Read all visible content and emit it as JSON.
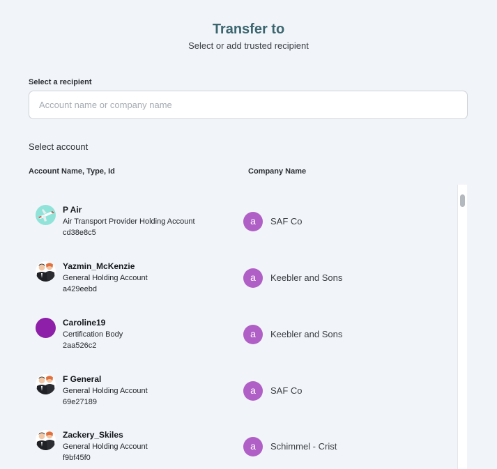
{
  "header": {
    "title": "Transfer to",
    "subtitle": "Select or add trusted recipient"
  },
  "recipient": {
    "label": "Select a recipient",
    "placeholder": "Account name or company name",
    "value": ""
  },
  "accounts": {
    "section_label": "Select account",
    "columns": {
      "account": "Account Name, Type, Id",
      "company": "Company Name"
    },
    "rows": [
      {
        "name": "P Air",
        "type": "Air Transport Provider Holding Account",
        "id": "cd38e8c5",
        "avatar_icon": "airplane-avatar-icon",
        "company_initial": "a",
        "company": "SAF Co"
      },
      {
        "name": "Yazmin_McKenzie",
        "type": "General Holding Account",
        "id": "a429eebd",
        "avatar_icon": "people-avatar-icon",
        "company_initial": "a",
        "company": "Keebler and Sons"
      },
      {
        "name": "Caroline19",
        "type": "Certification Body",
        "id": "2aa526c2",
        "avatar_icon": "purple-circle-avatar-icon",
        "company_initial": "a",
        "company": "Keebler and Sons"
      },
      {
        "name": "F General",
        "type": "General Holding Account",
        "id": "69e27189",
        "avatar_icon": "people-avatar-icon",
        "company_initial": "a",
        "company": "SAF Co"
      },
      {
        "name": "Zackery_Skiles",
        "type": "General Holding Account",
        "id": "f9bf45f0",
        "avatar_icon": "people-avatar-icon",
        "company_initial": "a",
        "company": "Schimmel - Crist"
      }
    ]
  },
  "colors": {
    "background": "#f1f4f8",
    "title": "#3b6670",
    "company_badge": "#b05fc6",
    "purple_avatar": "#8e1fa8",
    "avatar_teal": "#8fe3d9"
  }
}
